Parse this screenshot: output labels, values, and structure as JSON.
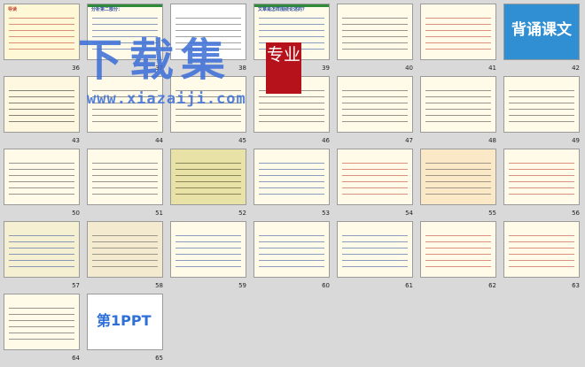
{
  "watermark": {
    "main": "下载集",
    "seal": "专业",
    "url": "www.xiazaiji.com"
  },
  "slides": [
    {
      "num": "36",
      "bg": "#fff8d6",
      "lc": "#c0392b",
      "title": "导读",
      "bar": ""
    },
    {
      "num": "37",
      "bg": "#fffbe8",
      "lc": "#2e4f9e",
      "title": "分析第二部分：",
      "bar": "#2e8b3a"
    },
    {
      "num": "38",
      "bg": "#ffffff",
      "lc": "#555",
      "title": "",
      "bar": ""
    },
    {
      "num": "39",
      "bg": "#fffbe8",
      "lc": "#2e4f9e",
      "title": "文章是怎样围绕论述的？",
      "bar": "#2e8b3a"
    },
    {
      "num": "40",
      "bg": "#fffbe8",
      "lc": "#444",
      "title": "",
      "bar": ""
    },
    {
      "num": "41",
      "bg": "#fffbe8",
      "lc": "#c0392b",
      "title": "",
      "bar": ""
    },
    {
      "num": "42",
      "bg": "#2f8fd2",
      "lc": "#ffffff",
      "title": "",
      "bar": "",
      "big": "背诵课文"
    },
    {
      "num": "43",
      "bg": "#fff8e0",
      "lc": "#222",
      "title": "",
      "bar": ""
    },
    {
      "num": "44",
      "bg": "#fffbe8",
      "lc": "#444",
      "title": "",
      "bar": ""
    },
    {
      "num": "45",
      "bg": "#fffbe8",
      "lc": "#444",
      "title": "",
      "bar": ""
    },
    {
      "num": "46",
      "bg": "#fffbe8",
      "lc": "#444",
      "title": "",
      "bar": ""
    },
    {
      "num": "47",
      "bg": "#fffbe8",
      "lc": "#444",
      "title": "",
      "bar": ""
    },
    {
      "num": "48",
      "bg": "#fffbe8",
      "lc": "#444",
      "title": "",
      "bar": ""
    },
    {
      "num": "49",
      "bg": "#fffbe8",
      "lc": "#444",
      "title": "",
      "bar": ""
    },
    {
      "num": "50",
      "bg": "#fffbe8",
      "lc": "#444",
      "title": "",
      "bar": ""
    },
    {
      "num": "51",
      "bg": "#fffbe8",
      "lc": "#444",
      "title": "",
      "bar": ""
    },
    {
      "num": "52",
      "bg": "#e9e2a6",
      "lc": "#3b3b1d",
      "title": "",
      "bar": ""
    },
    {
      "num": "53",
      "bg": "#fffbe8",
      "lc": "#2e4f9e",
      "title": "",
      "bar": ""
    },
    {
      "num": "54",
      "bg": "#fffbe8",
      "lc": "#c0392b",
      "title": "",
      "bar": ""
    },
    {
      "num": "55",
      "bg": "#fbe8c6",
      "lc": "#555",
      "title": "",
      "bar": ""
    },
    {
      "num": "56",
      "bg": "#fffbe8",
      "lc": "#c0392b",
      "title": "",
      "bar": ""
    },
    {
      "num": "57",
      "bg": "#f6f0d2",
      "lc": "#2e4f9e",
      "title": "",
      "bar": ""
    },
    {
      "num": "58",
      "bg": "#f3ead0",
      "lc": "#555",
      "title": "",
      "bar": ""
    },
    {
      "num": "59",
      "bg": "#fffbe8",
      "lc": "#2e4f9e",
      "title": "",
      "bar": ""
    },
    {
      "num": "60",
      "bg": "#fffbe8",
      "lc": "#2e4f9e",
      "title": "",
      "bar": ""
    },
    {
      "num": "61",
      "bg": "#fffbe8",
      "lc": "#2e4f9e",
      "title": "",
      "bar": ""
    },
    {
      "num": "62",
      "bg": "#fffbe8",
      "lc": "#c0392b",
      "title": "",
      "bar": ""
    },
    {
      "num": "63",
      "bg": "#fffbe8",
      "lc": "#c0392b",
      "title": "",
      "bar": ""
    },
    {
      "num": "64",
      "bg": "#fffbe8",
      "lc": "#444",
      "title": "",
      "bar": ""
    },
    {
      "num": "65",
      "bg": "#ffffff",
      "lc": "#2e6fd8",
      "title": "",
      "bar": "",
      "logo": "第1PPT"
    }
  ]
}
